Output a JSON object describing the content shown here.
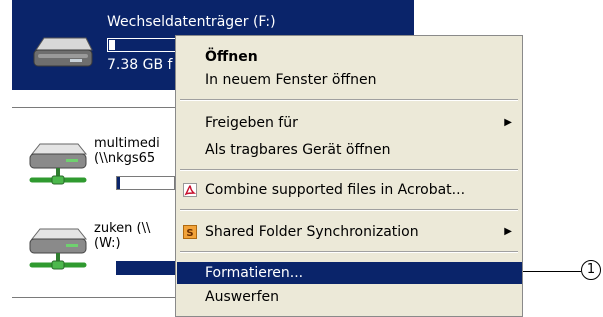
{
  "drives": {
    "selected": {
      "title": "Wechseldatenträger (F:)",
      "size_text": "7.38 GB f",
      "usage_fraction": 0.02,
      "icon": "removable-drive-icon"
    },
    "network1": {
      "title_line1": "multimedi",
      "title_line2": "(\\\\nkgs65",
      "usage_fraction": 0.06,
      "icon": "network-drive-icon"
    },
    "network2": {
      "title_line1": "zuken (\\\\",
      "title_line2": "(W:)",
      "usage_fraction": 1.0,
      "icon": "network-drive-icon"
    }
  },
  "context_menu": {
    "open": "Öffnen",
    "open_new_window": "In neuem Fenster öffnen",
    "share_with": "Freigeben für",
    "open_as_portable": "Als tragbares Gerät öffnen",
    "combine_acrobat": "Combine supported files in Acrobat...",
    "shared_folder_sync": "Shared Folder Synchronization",
    "format": "Formatieren...",
    "eject": "Auswerfen"
  },
  "callout": {
    "number": "1"
  },
  "colors": {
    "selection": "#0a246a",
    "menu_background": "#ece9d8",
    "acrobat_red": "#c8102e",
    "sync_orange": "#f2a33a"
  }
}
